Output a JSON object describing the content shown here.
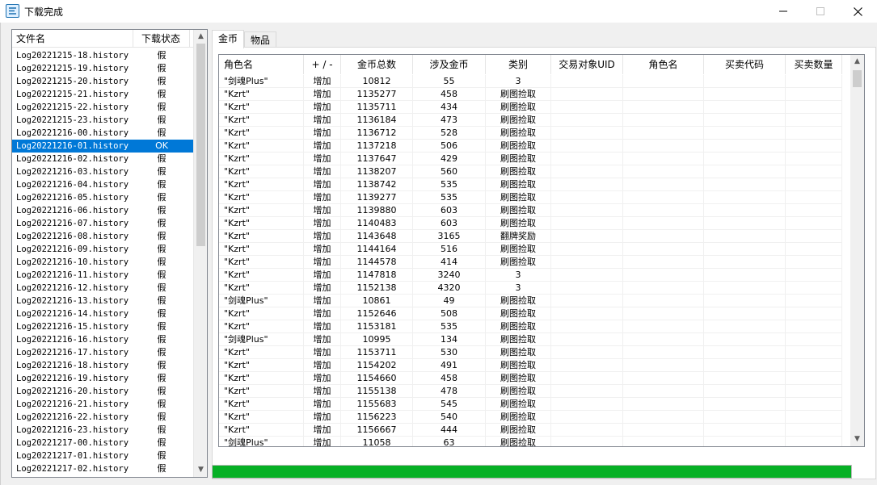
{
  "window": {
    "title": "下载完成"
  },
  "files": {
    "headers": {
      "name": "文件名",
      "status": "下载状态"
    },
    "rows": [
      {
        "name": "Log20221215-18.history",
        "status": "假"
      },
      {
        "name": "Log20221215-19.history",
        "status": "假"
      },
      {
        "name": "Log20221215-20.history",
        "status": "假"
      },
      {
        "name": "Log20221215-21.history",
        "status": "假"
      },
      {
        "name": "Log20221215-22.history",
        "status": "假"
      },
      {
        "name": "Log20221215-23.history",
        "status": "假"
      },
      {
        "name": "Log20221216-00.history",
        "status": "假"
      },
      {
        "name": "Log20221216-01.history",
        "status": "OK"
      },
      {
        "name": "Log20221216-02.history",
        "status": "假"
      },
      {
        "name": "Log20221216-03.history",
        "status": "假"
      },
      {
        "name": "Log20221216-04.history",
        "status": "假"
      },
      {
        "name": "Log20221216-05.history",
        "status": "假"
      },
      {
        "name": "Log20221216-06.history",
        "status": "假"
      },
      {
        "name": "Log20221216-07.history",
        "status": "假"
      },
      {
        "name": "Log20221216-08.history",
        "status": "假"
      },
      {
        "name": "Log20221216-09.history",
        "status": "假"
      },
      {
        "name": "Log20221216-10.history",
        "status": "假"
      },
      {
        "name": "Log20221216-11.history",
        "status": "假"
      },
      {
        "name": "Log20221216-12.history",
        "status": "假"
      },
      {
        "name": "Log20221216-13.history",
        "status": "假"
      },
      {
        "name": "Log20221216-14.history",
        "status": "假"
      },
      {
        "name": "Log20221216-15.history",
        "status": "假"
      },
      {
        "name": "Log20221216-16.history",
        "status": "假"
      },
      {
        "name": "Log20221216-17.history",
        "status": "假"
      },
      {
        "name": "Log20221216-18.history",
        "status": "假"
      },
      {
        "name": "Log20221216-19.history",
        "status": "假"
      },
      {
        "name": "Log20221216-20.history",
        "status": "假"
      },
      {
        "name": "Log20221216-21.history",
        "status": "假"
      },
      {
        "name": "Log20221216-22.history",
        "status": "假"
      },
      {
        "name": "Log20221216-23.history",
        "status": "假"
      },
      {
        "name": "Log20221217-00.history",
        "status": "假"
      },
      {
        "name": "Log20221217-01.history",
        "status": "假"
      },
      {
        "name": "Log20221217-02.history",
        "status": "假"
      }
    ],
    "selected_index": 7
  },
  "tabs": [
    {
      "label": "金币",
      "active": true
    },
    {
      "label": "物品",
      "active": false
    }
  ],
  "table": {
    "headers": [
      "角色名",
      "+ / -",
      "金币总数",
      "涉及金币",
      "类别",
      "交易对象UID",
      "角色名",
      "买卖代码",
      "买卖数量"
    ],
    "rows": [
      [
        "\"剑魂Plus\"",
        "增加",
        "10812",
        "55",
        "3"
      ],
      [
        "\"Kzrt\"",
        "增加",
        "1135277",
        "458",
        "刷图捡取"
      ],
      [
        "\"Kzrt\"",
        "增加",
        "1135711",
        "434",
        "刷图捡取"
      ],
      [
        "\"Kzrt\"",
        "增加",
        "1136184",
        "473",
        "刷图捡取"
      ],
      [
        "\"Kzrt\"",
        "增加",
        "1136712",
        "528",
        "刷图捡取"
      ],
      [
        "\"Kzrt\"",
        "增加",
        "1137218",
        "506",
        "刷图捡取"
      ],
      [
        "\"Kzrt\"",
        "增加",
        "1137647",
        "429",
        "刷图捡取"
      ],
      [
        "\"Kzrt\"",
        "增加",
        "1138207",
        "560",
        "刷图捡取"
      ],
      [
        "\"Kzrt\"",
        "增加",
        "1138742",
        "535",
        "刷图捡取"
      ],
      [
        "\"Kzrt\"",
        "增加",
        "1139277",
        "535",
        "刷图捡取"
      ],
      [
        "\"Kzrt\"",
        "增加",
        "1139880",
        "603",
        "刷图捡取"
      ],
      [
        "\"Kzrt\"",
        "增加",
        "1140483",
        "603",
        "刷图捡取"
      ],
      [
        "\"Kzrt\"",
        "增加",
        "1143648",
        "3165",
        "翻牌奖励"
      ],
      [
        "\"Kzrt\"",
        "增加",
        "1144164",
        "516",
        "刷图捡取"
      ],
      [
        "\"Kzrt\"",
        "增加",
        "1144578",
        "414",
        "刷图捡取"
      ],
      [
        "\"Kzrt\"",
        "增加",
        "1147818",
        "3240",
        "3"
      ],
      [
        "\"Kzrt\"",
        "增加",
        "1152138",
        "4320",
        "3"
      ],
      [
        "\"剑魂Plus\"",
        "增加",
        "10861",
        "49",
        "刷图捡取"
      ],
      [
        "\"Kzrt\"",
        "增加",
        "1152646",
        "508",
        "刷图捡取"
      ],
      [
        "\"Kzrt\"",
        "增加",
        "1153181",
        "535",
        "刷图捡取"
      ],
      [
        "\"剑魂Plus\"",
        "增加",
        "10995",
        "134",
        "刷图捡取"
      ],
      [
        "\"Kzrt\"",
        "增加",
        "1153711",
        "530",
        "刷图捡取"
      ],
      [
        "\"Kzrt\"",
        "增加",
        "1154202",
        "491",
        "刷图捡取"
      ],
      [
        "\"Kzrt\"",
        "增加",
        "1154660",
        "458",
        "刷图捡取"
      ],
      [
        "\"Kzrt\"",
        "增加",
        "1155138",
        "478",
        "刷图捡取"
      ],
      [
        "\"Kzrt\"",
        "增加",
        "1155683",
        "545",
        "刷图捡取"
      ],
      [
        "\"Kzrt\"",
        "增加",
        "1156223",
        "540",
        "刷图捡取"
      ],
      [
        "\"Kzrt\"",
        "增加",
        "1156667",
        "444",
        "刷图捡取"
      ],
      [
        "\"剑魂Plus\"",
        "增加",
        "11058",
        "63",
        "刷图捡取"
      ]
    ]
  },
  "progress": {
    "value": 1.0,
    "color": "#06b025"
  },
  "icons": {
    "app": "download-app-icon",
    "minimize": "minimize-icon",
    "maximize": "maximize-icon",
    "close": "close-icon"
  }
}
